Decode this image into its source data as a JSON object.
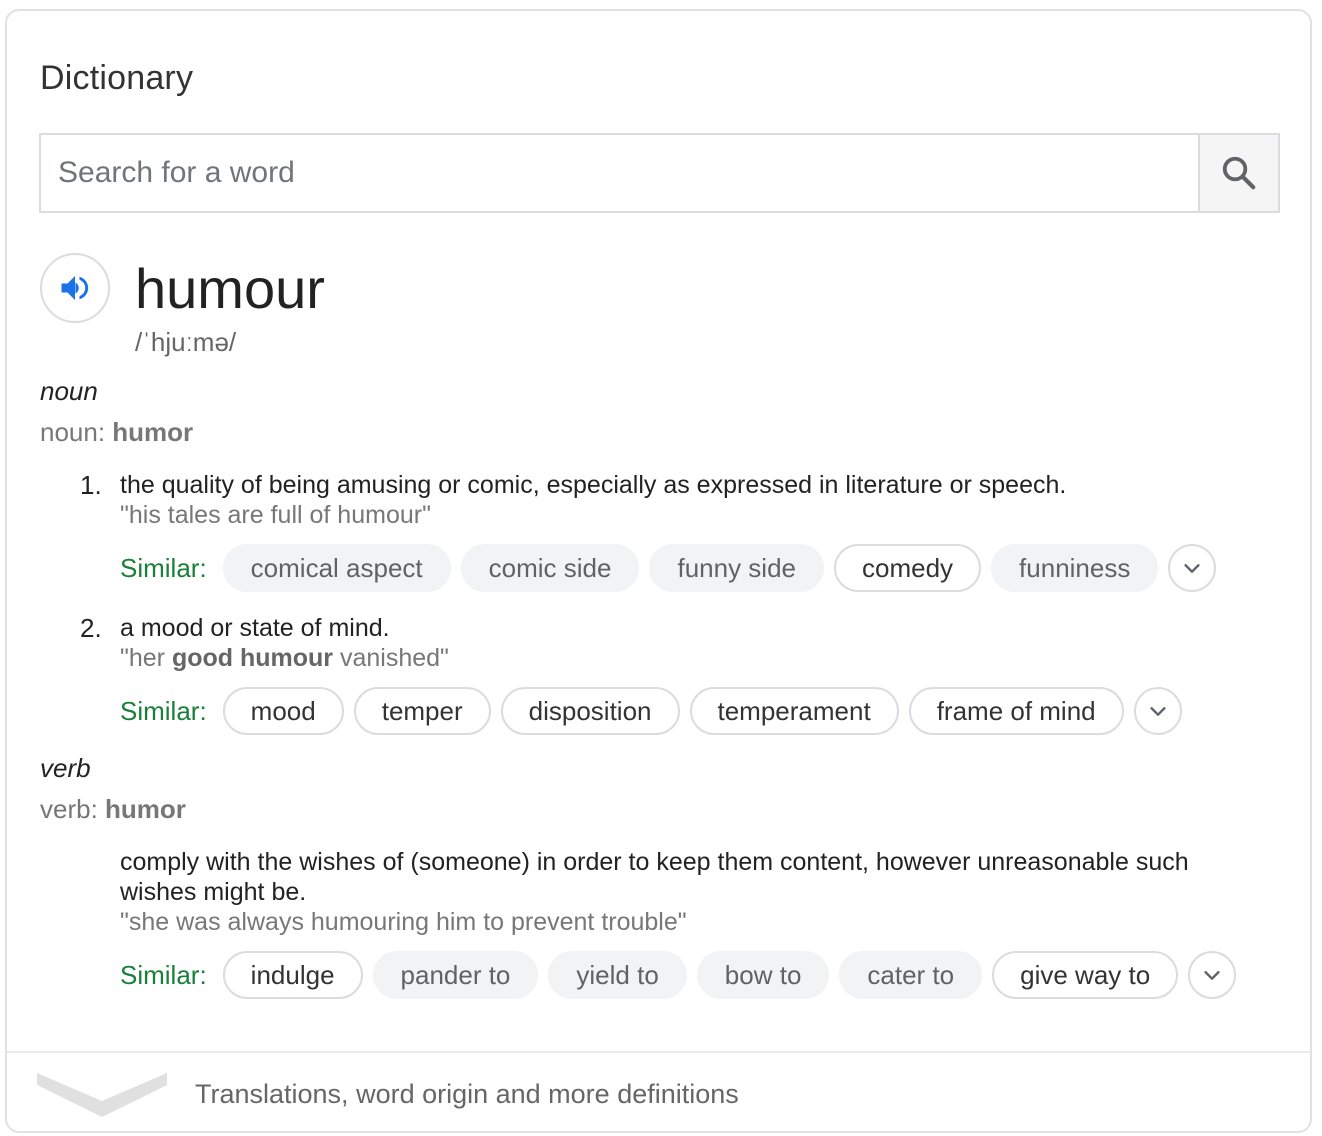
{
  "card": {
    "title": "Dictionary"
  },
  "search": {
    "placeholder": "Search for a word"
  },
  "entry": {
    "word": "humour",
    "phonetic": "/ˈhjuːmə/"
  },
  "noun": {
    "pos": "noun",
    "variant_prefix": "noun: ",
    "variant": "humor",
    "senses": [
      {
        "number": "1.",
        "definition": "the quality of being amusing or comic, especially as expressed in literature or speech.",
        "example": "\"his tales are full of humour\"",
        "similar_label": "Similar:",
        "similar": [
          {
            "label": "comical aspect",
            "style": "filled"
          },
          {
            "label": "comic side",
            "style": "filled"
          },
          {
            "label": "funny side",
            "style": "filled"
          },
          {
            "label": "comedy",
            "style": "outlined"
          },
          {
            "label": "funniness",
            "style": "filled"
          }
        ]
      },
      {
        "number": "2.",
        "definition": "a mood or state of mind.",
        "example_pre": "\"her ",
        "example_bold": "good humour",
        "example_post": " vanished\"",
        "similar_label": "Similar:",
        "similar": [
          {
            "label": "mood",
            "style": "outlined"
          },
          {
            "label": "temper",
            "style": "outlined"
          },
          {
            "label": "disposition",
            "style": "outlined"
          },
          {
            "label": "temperament",
            "style": "outlined"
          },
          {
            "label": "frame of mind",
            "style": "outlined"
          }
        ]
      }
    ]
  },
  "verb": {
    "pos": "verb",
    "variant_prefix": "verb: ",
    "variant": "humor",
    "senses": [
      {
        "definition": "comply with the wishes of (someone) in order to keep them content, however unreasonable such wishes might be.",
        "example": "\"she was always humouring him to prevent trouble\"",
        "similar_label": "Similar:",
        "similar": [
          {
            "label": "indulge",
            "style": "outlined"
          },
          {
            "label": "pander to",
            "style": "filled"
          },
          {
            "label": "yield to",
            "style": "filled"
          },
          {
            "label": "bow to",
            "style": "filled"
          },
          {
            "label": "cater to",
            "style": "filled"
          },
          {
            "label": "give way to",
            "style": "outlined"
          }
        ]
      }
    ]
  },
  "footer": {
    "label": "Translations, word origin and more definitions"
  },
  "colors": {
    "similar_label": "#188038",
    "speaker_icon": "#1a73e8",
    "chip_fill": "#f1f3f4",
    "border": "#dadce0"
  },
  "icons": {
    "search": "search-icon",
    "speaker": "speaker-icon",
    "expand": "chevron-down-icon",
    "footer": "chevron-down-icon"
  }
}
